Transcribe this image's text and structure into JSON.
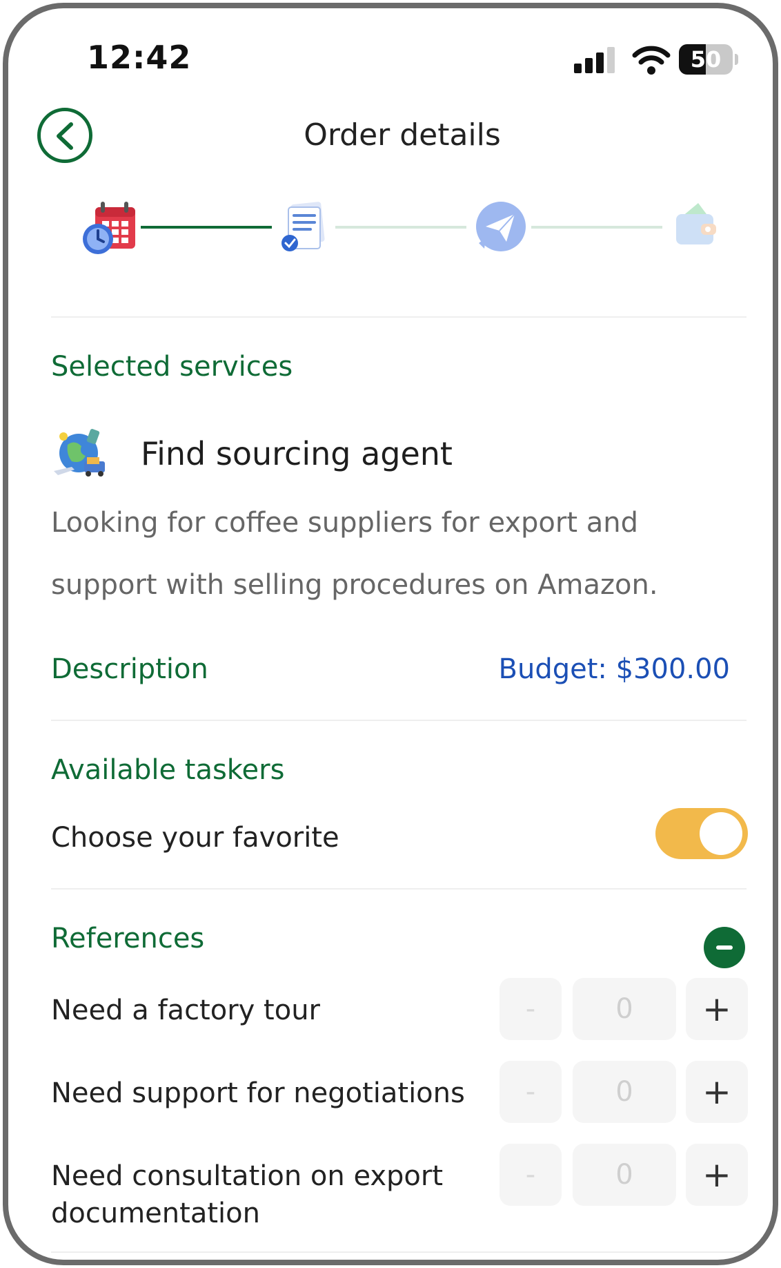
{
  "status_bar": {
    "time": "12:42",
    "battery_level": "50",
    "battery_percent": 50
  },
  "header": {
    "title": "Order details",
    "back_icon": "chevron-left-icon"
  },
  "progress_steps": {
    "steps": [
      "calendar-clock-icon",
      "document-check-icon",
      "paper-plane-icon",
      "wallet-icon"
    ],
    "completed_segments": 1
  },
  "selected_services": {
    "title": "Selected services",
    "service_name": "Find sourcing agent",
    "service_icon": "globe-shipping-icon",
    "note_line1": "Looking for coffee suppliers for export and",
    "note_line2": "support with selling procedures on Amazon."
  },
  "description": {
    "title": "Description",
    "budget": "Budget: $300.00"
  },
  "taskers": {
    "title": "Available taskers",
    "toggle_label": "Choose your favorite",
    "toggle_on": true
  },
  "references": {
    "title": "References",
    "items": [
      {
        "label": "Need a factory tour",
        "quantity": "0",
        "minus": "-",
        "plus": "+"
      },
      {
        "label": "Need support for negotiations",
        "quantity": "0",
        "minus": "-",
        "plus": "+"
      },
      {
        "label": "Need consultation on export documentation",
        "quantity": "0",
        "minus": "-",
        "plus": "+"
      }
    ]
  },
  "colors": {
    "brand_green": "#0f6b36",
    "budget_blue": "#1b4fb5",
    "toggle_yellow": "#f2b94b"
  }
}
